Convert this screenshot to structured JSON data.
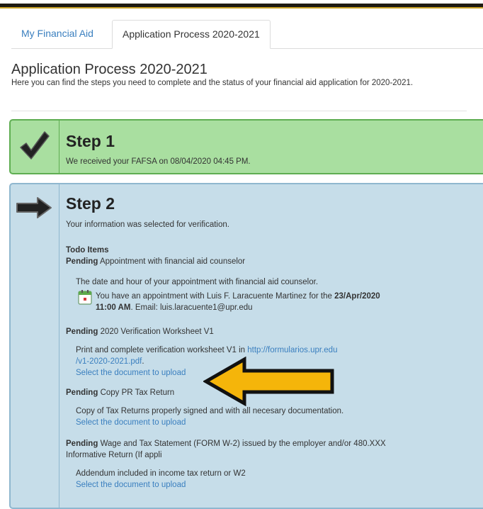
{
  "tabs": {
    "my_financial_aid": "My Financial Aid",
    "application_process": "Application Process 2020-2021"
  },
  "page": {
    "title": "Application Process 2020-2021",
    "description": "Here you can find the steps you need to complete and the status of your financial aid application for 2020-2021."
  },
  "step1": {
    "title": "Step 1",
    "text": "We received your FAFSA on 08/04/2020 04:45 PM.",
    "icon": "checkmark-icon"
  },
  "step2": {
    "title": "Step 2",
    "text": "Your information was selected for verification.",
    "icon": "arrow-right-icon",
    "todo_header": "Todo Items",
    "items": [
      {
        "status": "Pending",
        "name": "Appointment with financial aid counselor",
        "description": "The date and hour of your appointment with financial aid counselor.",
        "appointment_prefix": "You have an appointment with Luis F. Laracuente Martinez for the ",
        "appointment_date": "23/Apr/2020",
        "appointment_time": "11:00 AM",
        "appointment_email": ". Email: luis.laracuente1@upr.edu"
      },
      {
        "status": "Pending",
        "name": "2020 Verification Worksheet V1",
        "description_prefix": "Print and complete verification worksheet V1 in ",
        "link_line1": "http://formularios.upr.edu",
        "link_line2": "/v1-2020-2021.pdf",
        "link_suffix": ".",
        "upload_label": "Select the document to upload"
      },
      {
        "status": "Pending",
        "name": "Copy PR Tax Return",
        "description": "Copy of Tax Returns properly signed and with all necesary documentation.",
        "upload_label": "Select the document to upload"
      },
      {
        "status": "Pending",
        "name_line1": "Wage and Tax Statement (FORM W-2) issued by the employer and/or 480.XXX",
        "name_line2": "Informative Return (If appli",
        "description": "Addendum included in income tax return or W2",
        "upload_label": "Select the document to upload"
      }
    ]
  },
  "colors": {
    "step1_bg": "#a9dfa0",
    "step2_bg": "#c6dde9",
    "link": "#3a7fbf",
    "annotation_arrow": "#f5b50a"
  }
}
